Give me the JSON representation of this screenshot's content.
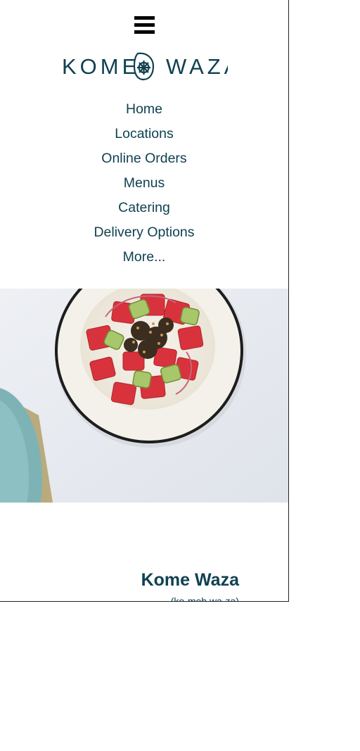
{
  "header": {
    "menu_icon": "hamburger-menu-icon",
    "logo": {
      "left_word": "KOME",
      "right_word": "WAZA",
      "color": "#0f4151"
    }
  },
  "nav": {
    "items": [
      {
        "label": "Home"
      },
      {
        "label": "Locations"
      },
      {
        "label": "Online Orders"
      },
      {
        "label": "Menus"
      },
      {
        "label": "Catering"
      },
      {
        "label": "Delivery Options"
      },
      {
        "label": "More..."
      }
    ]
  },
  "hero": {
    "image": "poke-bowl-photo"
  },
  "intro": {
    "title": "Kome Waza",
    "pronunciation": "(ko-meh wa-za)"
  },
  "colors": {
    "brand": "#0f4151",
    "background": "#ffffff"
  }
}
